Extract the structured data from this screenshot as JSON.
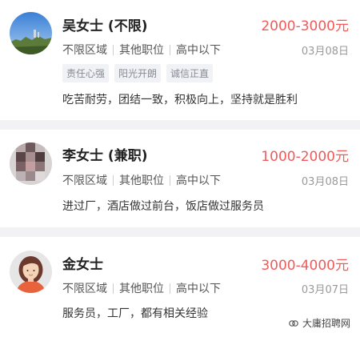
{
  "candidates": [
    {
      "name": "吴女士 (不限)",
      "salary": "2000-3000元",
      "meta": [
        "不限区域",
        "其他职位",
        "高中以下"
      ],
      "date": "03月08日",
      "tags": [
        "责任心强",
        "阳光开朗",
        "诚信正直"
      ],
      "description": "吃苦耐劳，团结一致，积极向上，坚持就是胜利"
    },
    {
      "name": "李女士 (兼职)",
      "salary": "1000-2000元",
      "meta": [
        "不限区域",
        "其他职位",
        "高中以下"
      ],
      "date": "03月08日",
      "description": "进过厂，酒店做过前台，饭店做过服务员"
    },
    {
      "name": "金女士",
      "salary": "3000-4000元",
      "meta": [
        "不限区域",
        "其他职位",
        "高中以下"
      ],
      "date": "03月07日",
      "description": "服务员，工厂，都有相关经验"
    }
  ],
  "watermark": "大庸招聘网",
  "icons": {
    "watermark": "wechat-logo-icon"
  },
  "colors": {
    "salary": "#f05a5a",
    "tag_bg": "#f1f2f6",
    "background": "#f2f2f5"
  }
}
